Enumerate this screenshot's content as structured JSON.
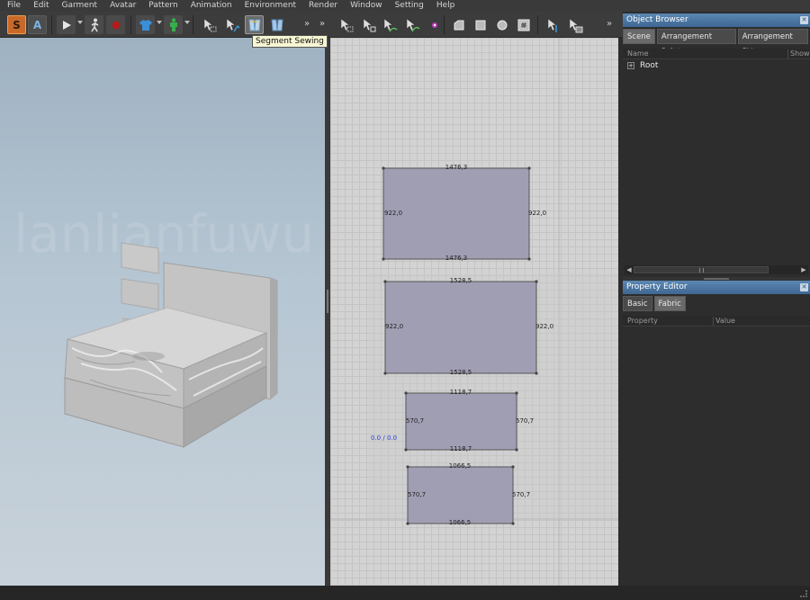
{
  "menu": [
    "File",
    "Edit",
    "Garment",
    "Avatar",
    "Pattern",
    "Animation",
    "Environment",
    "Render",
    "Window",
    "Setting",
    "Help"
  ],
  "toolbar": {
    "mode_buttons": [
      "S",
      "A"
    ],
    "more_glyph": "»",
    "tooltip": "Segment Sewing"
  },
  "viewport2d": {
    "coordinate_readout": "0.0 / 0.0",
    "patterns": [
      {
        "top": "1476,3",
        "bottom": "1476,3",
        "left": "922,0",
        "right": "922,0"
      },
      {
        "top": "1528,5",
        "bottom": "1528,5",
        "left": "922,0",
        "right": "922,0"
      },
      {
        "top": "1118,7",
        "bottom": "1118,7",
        "left": "570,7",
        "right": "570,7"
      },
      {
        "top": "1066,5",
        "bottom": "1066,5",
        "left": "570,7",
        "right": "570,7"
      }
    ]
  },
  "object_browser": {
    "title": "Object Browser",
    "tabs": [
      "Scene",
      "Arrangement Point",
      "Arrangement BV"
    ],
    "active_tab": "Scene",
    "columns": [
      "Name",
      "Show"
    ],
    "tree": [
      {
        "label": "Root",
        "expander": "+"
      }
    ]
  },
  "property_editor": {
    "title": "Property Editor",
    "tabs": [
      "Basic",
      "Fabric"
    ],
    "active_tab": "Fabric",
    "columns": [
      "Property",
      "Value"
    ]
  },
  "colors": {
    "panel_title": "#4a76a3",
    "pattern_fill": "#a09eb3",
    "coordinate_text": "#2a3fd6",
    "accent_orange": "#e07a2e"
  }
}
